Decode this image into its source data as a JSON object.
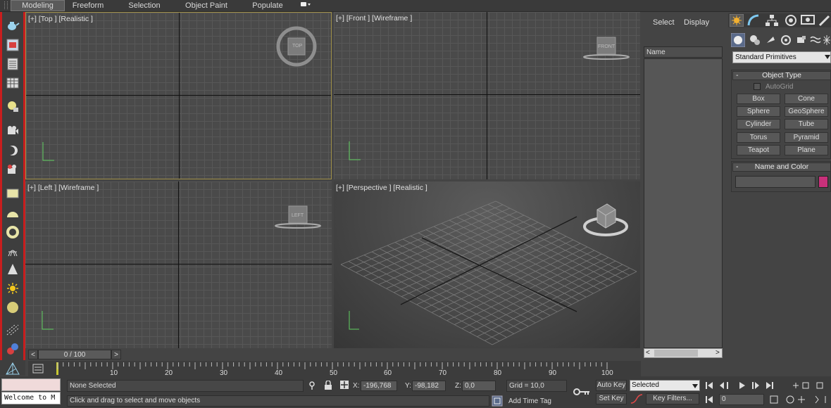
{
  "ribbon": {
    "tabs": [
      "Modeling",
      "Freeform",
      "Selection",
      "Object Paint",
      "Populate"
    ]
  },
  "viewports": {
    "top": "[+] [Top ] [Realistic ]",
    "front": "[+] [Front ] [Wireframe ]",
    "left": "[+] [Left ] [Wireframe ]",
    "perspective": "[+] [Perspective ] [Realistic ]",
    "cube_top": "TOP",
    "cube_front": "FRONT",
    "cube_left": "LEFT"
  },
  "explorer": {
    "select_tab": "Select",
    "display_tab": "Display",
    "name_header": "Name"
  },
  "command_panel": {
    "category": "Standard Primitives",
    "object_type_title": "Object Type",
    "autogrid": "AutoGrid",
    "buttons": [
      "Box",
      "Cone",
      "Sphere",
      "GeoSphere",
      "Cylinder",
      "Tube",
      "Torus",
      "Pyramid",
      "Teapot",
      "Plane"
    ],
    "name_color_title": "Name and Color",
    "object_color": "#c8307a"
  },
  "timeline": {
    "frame": "0 / 100",
    "ticks": [
      "10",
      "20",
      "30",
      "40",
      "50",
      "60",
      "70",
      "80",
      "90",
      "100"
    ]
  },
  "status": {
    "maxscript": "Welcome to M",
    "selection": "None Selected",
    "prompt": "Click and drag to select and move objects",
    "x_label": "X:",
    "x_value": "-196,768",
    "y_label": "Y:",
    "y_value": "-98,182",
    "z_label": "Z:",
    "z_value": "0,0",
    "grid": "Grid = 10,0",
    "add_time_tag": "Add Time Tag",
    "auto_key": "Auto Key",
    "set_key": "Set Key",
    "key_mode": "Selected",
    "key_filters": "Key Filters...",
    "current_frame": "0"
  }
}
